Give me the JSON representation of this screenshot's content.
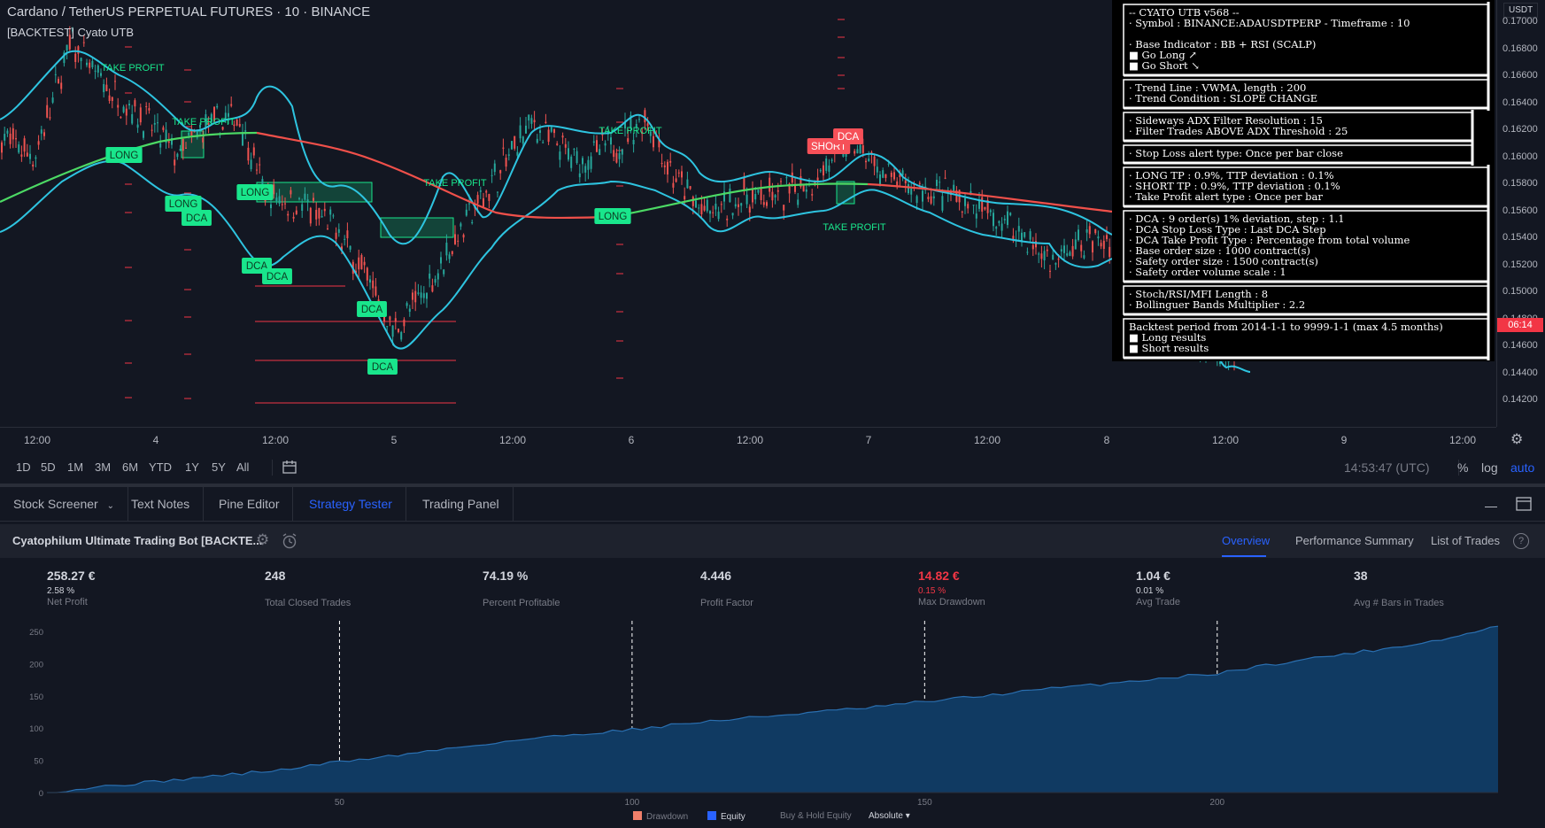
{
  "chart": {
    "title": "Cardano / TetherUS PERPETUAL FUTURES · 10 · BINANCE",
    "indicator": "[BACKTEST] Cyato UTB",
    "currency_label": "USDT",
    "price_ticks": [
      "0.17000",
      "0.16800",
      "0.16600",
      "0.16400",
      "0.16200",
      "0.16000",
      "0.15800",
      "0.15600",
      "0.15400",
      "0.15200",
      "0.15000",
      "0.14800",
      "0.14600",
      "0.14400",
      "0.14200"
    ],
    "countdown": "06:14",
    "time_ticks": [
      "12:00",
      "4",
      "12:00",
      "5",
      "12:00",
      "6",
      "12:00",
      "7",
      "12:00",
      "8",
      "12:00",
      "9",
      "12:00"
    ],
    "signals": [
      {
        "label": "TAKE PROFIT",
        "kind": "tp"
      },
      {
        "label": "LONG",
        "kind": "long"
      },
      {
        "label": "TAKE PROFIT",
        "kind": "tp"
      },
      {
        "label": "LONG",
        "kind": "long"
      },
      {
        "label": "DCA",
        "kind": "long"
      },
      {
        "label": "LONG",
        "kind": "long"
      },
      {
        "label": "DCA",
        "kind": "long"
      },
      {
        "label": "DCA",
        "kind": "long"
      },
      {
        "label": "DCA",
        "kind": "long"
      },
      {
        "label": "DCA",
        "kind": "long"
      },
      {
        "label": "TAKE PROFIT",
        "kind": "tp"
      },
      {
        "label": "TAKE PROFIT",
        "kind": "tp"
      },
      {
        "label": "LONG",
        "kind": "long"
      },
      {
        "label": "SHORT",
        "kind": "short"
      },
      {
        "label": "DCA",
        "kind": "short"
      },
      {
        "label": "TAKE PROFIT",
        "kind": "tp"
      }
    ],
    "colors": {
      "candle_up": "#26a69a",
      "candle_down": "#ef5350",
      "band": "#2ec4e0",
      "trend_up": "#4cd964",
      "trend_down": "#f0504a",
      "signal_green": "#19e68c",
      "signal_red": "#f65058"
    }
  },
  "info_panel": {
    "sections": [
      [
        "-- CYATO UTB v568 --",
        "· Symbol : BINANCE:ADAUSDTPERP - Timeframe : 10",
        "",
        "· Base Indicator : BB + RSI (SCALP)",
        "■ Go Long ↗",
        "■ Go Short ↘"
      ],
      [
        "· Trend Line : VWMA, length : 200",
        "· Trend Condition : SLOPE CHANGE"
      ],
      [
        "· Sideways ADX Filter Resolution : 15",
        "· Filter Trades ABOVE ADX Threshold : 25"
      ],
      [
        "· Stop Loss alert type: Once per bar close"
      ],
      [
        "· LONG TP : 0.9%, TTP deviation : 0.1%",
        "· SHORT TP : 0.9%, TTP deviation : 0.1%",
        "· Take Profit alert type : Once per bar"
      ],
      [
        "· DCA : 9 order(s) 1% deviation, step : 1.1",
        "· DCA Stop Loss Type : Last DCA Step",
        "· DCA Take Profit Type : Percentage from total volume",
        "· Base order size : 1000 contract(s)",
        "· Safety order size : 1500 contract(s)",
        "· Safety order volume scale : 1"
      ],
      [
        "· Stoch/RSI/MFI Length : 8",
        "· Bollinguer Bands Multiplier : 2.2"
      ],
      [
        "Backtest period from 2014-1-1 to 9999-1-1 (max 4.5 months)",
        "■ Long results",
        "■ Short results"
      ]
    ]
  },
  "range_bar": {
    "ranges": [
      "1D",
      "5D",
      "1M",
      "3M",
      "6M",
      "YTD",
      "1Y",
      "5Y",
      "All"
    ],
    "clock": "14:53:47 (UTC)",
    "percent": "%",
    "log": "log",
    "auto": "auto"
  },
  "bottom_tabs": {
    "stock_screener": "Stock Screener",
    "text_notes": "Text Notes",
    "pine_editor": "Pine Editor",
    "strategy_tester": "Strategy Tester",
    "trading_panel": "Trading Panel"
  },
  "strategy": {
    "name": "Cyatophilum Ultimate Trading Bot [BACKTE...",
    "tabs": {
      "overview": "Overview",
      "performance": "Performance Summary",
      "trades": "List of Trades"
    }
  },
  "metrics": {
    "net_profit": {
      "value": "258.27 €",
      "sub": "2.58 %",
      "label": "Net Profit"
    },
    "total_closed": {
      "value": "248",
      "label": "Total Closed Trades"
    },
    "percent_profitable": {
      "value": "74.19 %",
      "label": "Percent Profitable"
    },
    "profit_factor": {
      "value": "4.446",
      "label": "Profit Factor"
    },
    "max_drawdown": {
      "value": "14.82 €",
      "sub": "0.15 %",
      "label": "Max Drawdown"
    },
    "avg_trade": {
      "value": "1.04 €",
      "sub": "0.01 %",
      "label": "Avg Trade"
    },
    "avg_bars": {
      "value": "38",
      "label": "Avg # Bars in Trades"
    }
  },
  "equity": {
    "y_ticks": [
      "250",
      "200",
      "150",
      "100",
      "50",
      "0"
    ],
    "x_ticks": [
      "50",
      "100",
      "150",
      "200"
    ],
    "legend": {
      "drawdown": "Drawdown",
      "equity": "Equity",
      "buy_hold": "Buy & Hold Equity",
      "absolute": "Absolute"
    },
    "colors": {
      "drawdown": "#ef7f6a",
      "equity": "#2962ff",
      "area": "#103a62",
      "line": "#2a6fb0"
    }
  },
  "chart_data": {
    "type": "area",
    "xlabel": "",
    "ylabel": "",
    "xlim": [
      0,
      248
    ],
    "ylim": [
      0,
      258.27
    ],
    "x": [
      0,
      10,
      20,
      30,
      40,
      50,
      60,
      70,
      80,
      90,
      100,
      110,
      120,
      130,
      140,
      150,
      160,
      170,
      180,
      190,
      200,
      210,
      220,
      230,
      240,
      248
    ],
    "series": [
      {
        "name": "Equity",
        "values": [
          0,
          10,
          18,
          27,
          35,
          48,
          58,
          70,
          81,
          90,
          98,
          108,
          116,
          124,
          131,
          141,
          150,
          160,
          168,
          177,
          185,
          200,
          213,
          225,
          240,
          258
        ]
      }
    ],
    "grid": false,
    "legend_position": "bottom"
  }
}
